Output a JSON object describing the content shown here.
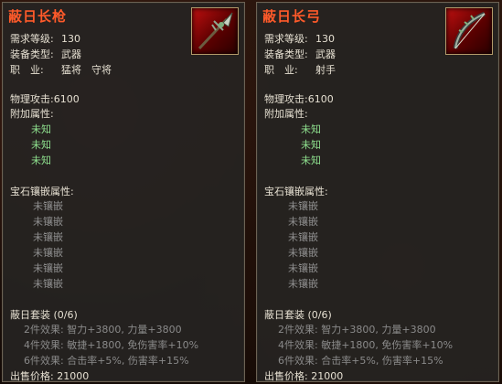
{
  "items": [
    {
      "name": "蔽日长枪",
      "icon": "spear-icon",
      "req_level_label": "需求等级:",
      "req_level": "130",
      "equip_type_label": "装备类型:",
      "equip_type": "武器",
      "class_label": "职　业:",
      "class_value": "猛将　守将",
      "phys_attack": "物理攻击:6100",
      "extra_attr_label": "附加属性:",
      "extra_attrs": [
        "未知",
        "未知",
        "未知"
      ],
      "gem_label": "宝石镶嵌属性:",
      "gems": [
        "未镶嵌",
        "未镶嵌",
        "未镶嵌",
        "未镶嵌",
        "未镶嵌",
        "未镶嵌"
      ],
      "set_title": "蔽日套装 (0/6)",
      "set_bonuses": [
        "2件效果: 智力+3800, 力量+3800",
        "4件效果: 敏捷+1800, 免伤害率+10%",
        "6件效果: 合击率+5%, 伤害率+15%"
      ],
      "sell_price": "出售价格: 21000"
    },
    {
      "name": "蔽日长弓",
      "icon": "bow-icon",
      "req_level_label": "需求等级:",
      "req_level": "130",
      "equip_type_label": "装备类型:",
      "equip_type": "武器",
      "class_label": "职　业:",
      "class_value": "射手",
      "phys_attack": "物理攻击:6100",
      "extra_attr_label": "附加属性:",
      "extra_attrs": [
        "未知",
        "未知",
        "未知"
      ],
      "gem_label": "宝石镶嵌属性:",
      "gems": [
        "未镶嵌",
        "未镶嵌",
        "未镶嵌",
        "未镶嵌",
        "未镶嵌",
        "未镶嵌"
      ],
      "set_title": "蔽日套装 (0/6)",
      "set_bonuses": [
        "2件效果: 智力+3800, 力量+3800",
        "4件效果: 敏捷+1800, 免伤害率+10%",
        "6件效果: 合击率+5%, 伤害率+15%"
      ],
      "sell_price": "出售价格: 21000"
    }
  ]
}
